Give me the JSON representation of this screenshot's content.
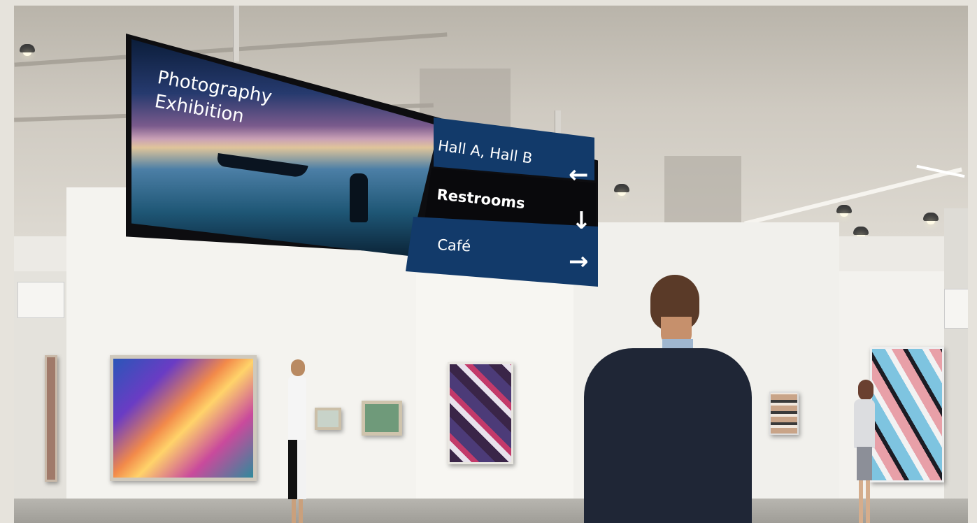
{
  "sign": {
    "title_line1": "Photography",
    "title_line2": "Exhibition",
    "directions": [
      {
        "label": "Hall A, Hall B",
        "arrow": "←",
        "arrow_icon": "arrow-left-icon",
        "panel_color": "#123a6a"
      },
      {
        "label": "Restrooms",
        "arrow": "↓",
        "arrow_icon": "arrow-down-icon",
        "panel_color": "#09090c"
      },
      {
        "label": "Café",
        "arrow": "→",
        "arrow_icon": "arrow-right-icon",
        "panel_color": "#123a6a"
      }
    ]
  },
  "colors": {
    "sign_blue": "#123a6a",
    "sign_black": "#09090c",
    "wall": "#f3f2ee",
    "ceiling": "#cfcac1"
  }
}
